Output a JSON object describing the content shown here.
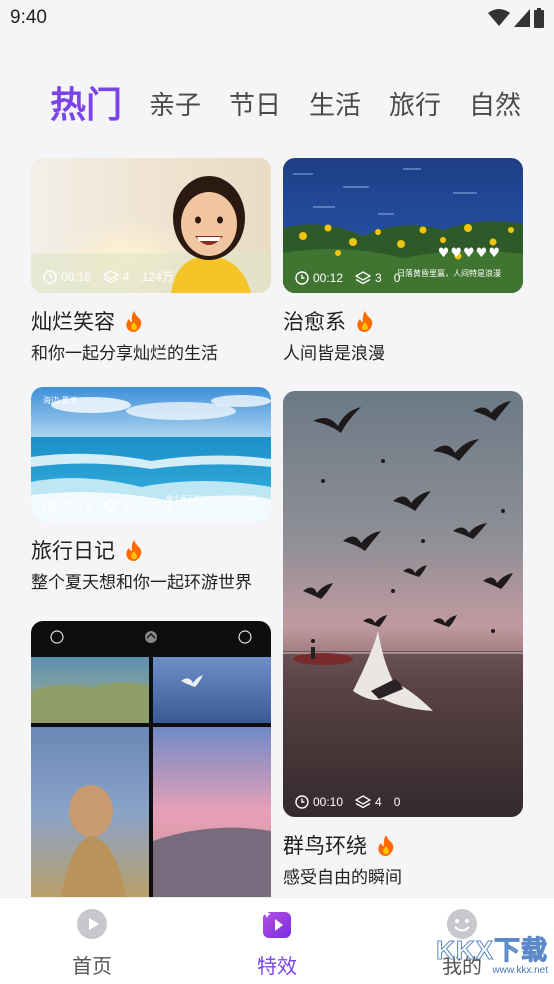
{
  "status": {
    "time": "9:40"
  },
  "tabs": [
    {
      "label": "热门",
      "active": true
    },
    {
      "label": "亲子"
    },
    {
      "label": "节日"
    },
    {
      "label": "生活"
    },
    {
      "label": "旅行"
    },
    {
      "label": "自然"
    }
  ],
  "cards": {
    "smile": {
      "title": "灿烂笑容",
      "subtitle": "和你一起分享灿烂的生活",
      "duration": "00:16",
      "layers": "4",
      "views": "124万"
    },
    "healing": {
      "title": "治愈系",
      "subtitle": "人间皆是浪漫",
      "duration": "00:12",
      "layers": "3",
      "views": "0",
      "overlay_text": "♥♥♥♥♥",
      "overlay_caption": "日落黄昏里赢，人间特是浪漫"
    },
    "travel": {
      "title": "旅行日记",
      "subtitle": "整个夏天想和你一起环游世界",
      "duration": "00:15",
      "layers": "3",
      "views": "183万",
      "overlay_top": "海边·夏天",
      "overlay_caption": "整个夏天想和你一起环游世界"
    },
    "birds": {
      "title": "群鸟环绕",
      "subtitle": "感受自由的瞬间",
      "duration": "00:10",
      "layers": "4",
      "views": "0"
    },
    "collage": {}
  },
  "nav": [
    {
      "label": "首页",
      "icon": "play-circle-icon"
    },
    {
      "label": "特效",
      "icon": "effects-icon",
      "active": true
    },
    {
      "label": "我的",
      "icon": "smiley-icon"
    }
  ],
  "watermark": {
    "text": "KKX下载",
    "sub": "www.kkx.net"
  },
  "colors": {
    "accent": "#7a44e8",
    "fire": "#ff6a00",
    "background": "#f5f5f7"
  }
}
